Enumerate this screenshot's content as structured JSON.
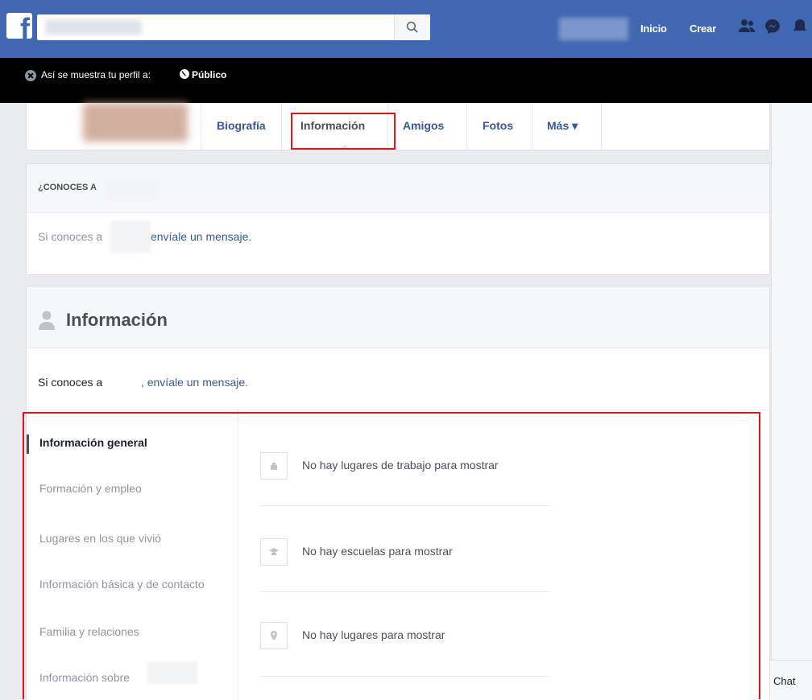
{
  "topbar": {
    "search": {
      "placeholder": ""
    },
    "nav": {
      "home_label": "Inicio",
      "create_label": "Crear"
    },
    "icons": [
      "facebook-logo-icon",
      "search-icon",
      "friends-icon",
      "messenger-icon",
      "notifications-icon"
    ],
    "brand_color": "#4267b2"
  },
  "public_bar": {
    "text": "Así se muestra tu perfil a:",
    "audience": "Público"
  },
  "profile_tabs": {
    "items": [
      {
        "label": "Biografía"
      },
      {
        "label": "Información"
      },
      {
        "label": "Amigos"
      },
      {
        "label": "Fotos"
      },
      {
        "label": "Más ▾"
      }
    ],
    "active": "Información"
  },
  "know_card": {
    "heading": "¿CONOCES A",
    "body_prefix": "Si conoces a",
    "body_link": "envíale un mensaje."
  },
  "info_card": {
    "title": "Información",
    "subtitle_prefix": "Si conoces a",
    "subtitle_link": ", envíale un mensaje.",
    "sidebar": [
      {
        "label": "Información general",
        "active": true
      },
      {
        "label": "Formación y empleo"
      },
      {
        "label": "Lugares en los que vivió"
      },
      {
        "label": "Información básica y de contacto"
      },
      {
        "label": "Familia y relaciones"
      },
      {
        "label": "Información sobre"
      }
    ],
    "rows": [
      {
        "icon": "workplace-icon",
        "text": "No hay lugares de trabajo para mostrar"
      },
      {
        "icon": "school-icon",
        "text": "No hay escuelas para mostrar"
      },
      {
        "icon": "location-pin-icon",
        "text": "No hay lugares para mostrar"
      }
    ]
  },
  "chat": {
    "label": "Chat"
  },
  "annotation_color": "#e4121a"
}
